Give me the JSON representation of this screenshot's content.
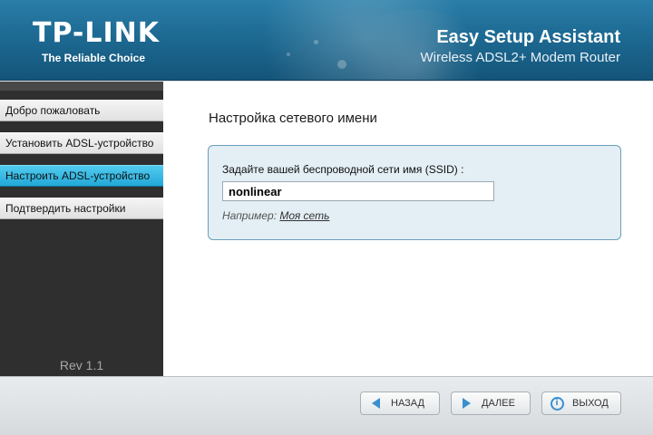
{
  "header": {
    "logo": "TP-LINK",
    "tagline": "The Reliable Choice",
    "title": "Easy Setup Assistant",
    "subtitle": "Wireless ADSL2+ Modem Router"
  },
  "sidebar": {
    "items": [
      {
        "label": "Добро пожаловать",
        "active": false
      },
      {
        "label": "Установить ADSL-устройство",
        "active": false
      },
      {
        "label": "Настроить ADSL-устройство",
        "active": true
      },
      {
        "label": "Подтвердить настройки",
        "active": false
      }
    ],
    "version": "Rev 1.1"
  },
  "main": {
    "section_title": "Настройка сетевого имени",
    "ssid_label": "Задайте вашей беспроводной сети имя (SSID) :",
    "ssid_value": "nonlinear",
    "example_prefix": "Например: ",
    "example_link": "Моя сеть"
  },
  "footer": {
    "back_label": "НАЗАД",
    "next_label": "ДАЛЕЕ",
    "exit_label": "ВЫХОД"
  },
  "colors": {
    "header_blue": "#1d6a93",
    "active_nav": "#23a8d8",
    "icon_blue": "#3b8fd0"
  }
}
